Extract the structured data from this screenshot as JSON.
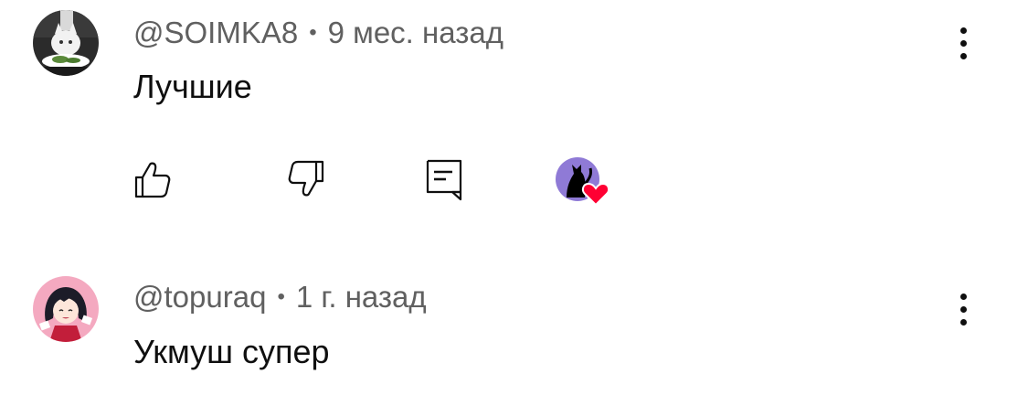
{
  "comments": [
    {
      "author": "@SOIMKA8",
      "separator": "•",
      "time": "9 мес. назад",
      "text": "Лучшие",
      "avatar_icon": "cat-meme-avatar",
      "actions": {
        "like_icon": "thumbs-up-icon",
        "dislike_icon": "thumbs-down-icon",
        "reply_icon": "reply-icon",
        "creator_heart_icon": "creator-heart-icon"
      }
    },
    {
      "author": "@topuraq",
      "separator": "•",
      "time": "1 г. назад",
      "text": "Укмуш супер",
      "avatar_icon": "anime-avatar"
    }
  ],
  "colors": {
    "meta_text": "#606060",
    "body_text": "#0f0f0f",
    "heart": "#ff0033",
    "creator_avatar_bg": "#8f7ad6",
    "anime_avatar_bg": "#f4a9c0"
  }
}
